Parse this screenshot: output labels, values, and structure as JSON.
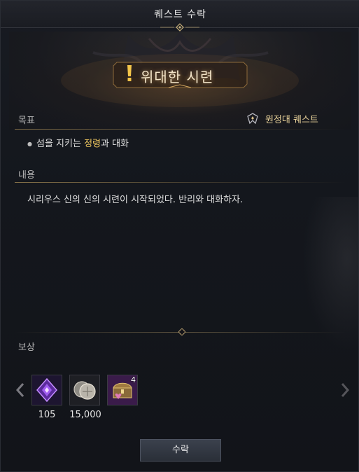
{
  "window": {
    "title": "퀘스트 수락"
  },
  "quest": {
    "title": "위대한 시련",
    "type_label": "원정대 퀘스트"
  },
  "sections": {
    "objective_label": "목표",
    "content_label": "내용",
    "reward_label": "보상"
  },
  "objective": {
    "prefix": "섬을 지키는 ",
    "highlight": "정령",
    "suffix": "과 대화"
  },
  "content": {
    "text": "시리우스 신의 신의 시련이 시작되었다. 반리와 대화하자."
  },
  "rewards": [
    {
      "icon": "purple-crystal-icon",
      "count": "105",
      "badge": ""
    },
    {
      "icon": "silver-coins-icon",
      "count": "15,000",
      "badge": ""
    },
    {
      "icon": "treasure-chest-icon",
      "count": "",
      "badge": "4"
    }
  ],
  "buttons": {
    "accept": "수락"
  },
  "colors": {
    "highlight": "#f0c860",
    "expedition": "#e9d29a",
    "title_glow": "#f2e4c8"
  }
}
